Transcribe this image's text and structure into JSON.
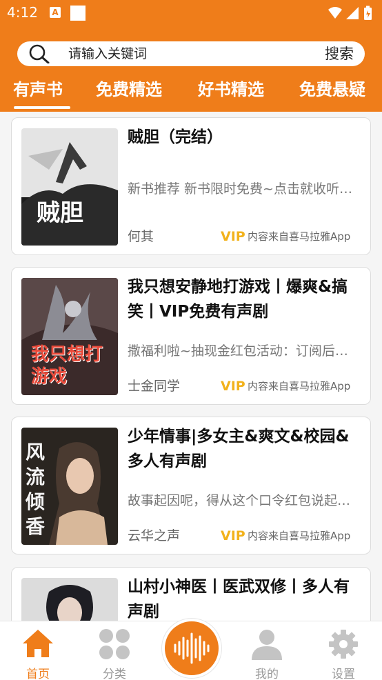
{
  "status_bar": {
    "time": "4:12",
    "notification_letter": "A"
  },
  "search": {
    "placeholder": "请输入关键词",
    "button_label": "搜索"
  },
  "tabs": [
    "有声书",
    "免费精选",
    "好书精选",
    "免费悬疑"
  ],
  "books": [
    {
      "title": "贼胆（完结）",
      "desc": "新书推荐 新书限时免费~点击就收听，快来看看吧",
      "author": "何其",
      "vip": "VIP",
      "source": "内容来自喜马拉雅App",
      "cover_text": "贼胆"
    },
    {
      "title": "我只想安静地打游戏丨爆爽&搞笑丨VIP免费有声剧",
      "desc": "撒福利啦~抽现金红包活动：订阅后即可参与",
      "author": "士金同学",
      "vip": "VIP",
      "source": "内容来自喜马拉雅App",
      "cover_text": "我只想打游戏"
    },
    {
      "title": "少年情事|多女主&爽文&校园&多人有声剧",
      "desc": "故事起因呢，得从这个口令红包说起…",
      "author": "云华之声",
      "vip": "VIP",
      "source": "内容来自喜马拉雅App",
      "cover_text": "风流倾香"
    },
    {
      "title": "山村小神医丨医武双修丨多人有声剧",
      "desc": "",
      "author": "",
      "vip": "",
      "source": "",
      "cover_text": ""
    }
  ],
  "nav": [
    {
      "label": "首页",
      "icon": "home-icon",
      "active": true
    },
    {
      "label": "分类",
      "icon": "grid-icon",
      "active": false
    },
    {
      "label": "",
      "icon": "audio-wave-icon",
      "active": false
    },
    {
      "label": "我的",
      "icon": "user-icon",
      "active": false
    },
    {
      "label": "设置",
      "icon": "gear-icon",
      "active": false
    }
  ],
  "colors": {
    "brand_orange": "#ef7d1a",
    "vip_gold": "#f2b21c"
  }
}
